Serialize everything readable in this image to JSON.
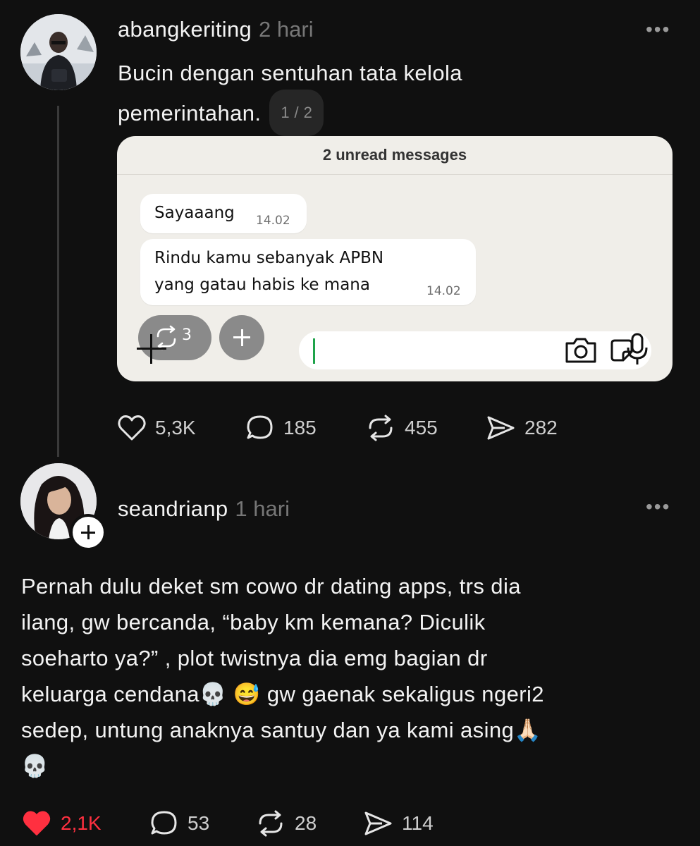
{
  "post1": {
    "username": "abangkeriting",
    "time": "2 hari",
    "text_line1": "Bucin dengan sentuhan tata kelola",
    "text_line2": "pemerintahan.",
    "pager": "1 / 2",
    "more": "•••",
    "chat": {
      "header": "2 unread messages",
      "msg1_text": "Sayaaang",
      "msg1_time": "14.02",
      "msg2_line1": "Rindu kamu sebanyak APBN",
      "msg2_line2": "yang gatau habis ke mana",
      "msg2_time": "14.02",
      "repost_count": "3"
    },
    "likes": "5,3K",
    "replies": "185",
    "reposts": "455",
    "shares": "282"
  },
  "post2": {
    "username": "seandrianp",
    "time": "1 hari",
    "more": "•••",
    "lines": [
      "Pernah dulu deket sm cowo dr dating apps, trs dia",
      "ilang, gw bercanda,  “baby km kemana? Diculik",
      "soeharto ya?” , plot twistnya dia emg bagian dr",
      "keluarga cendana💀 😅 gw gaenak sekaligus ngeri2",
      "sedep, untung anaknya santuy dan ya kami asing🙏🏻",
      "💀"
    ],
    "likes": "2,1K",
    "replies": "53",
    "reposts": "28",
    "shares": "114"
  },
  "colors": {
    "background": "#101010",
    "liked": "#ff3040",
    "muted": "#777777"
  }
}
